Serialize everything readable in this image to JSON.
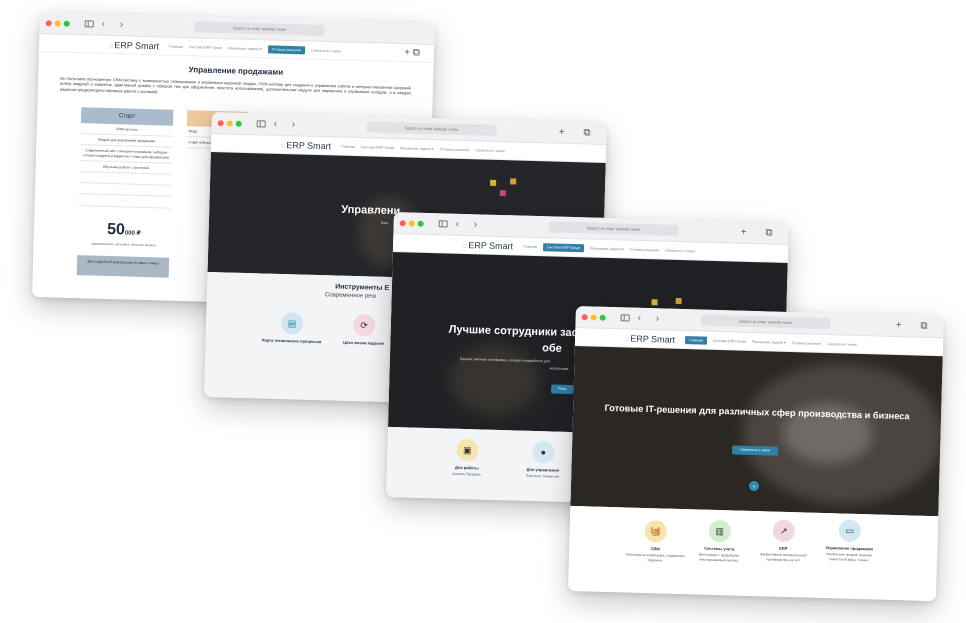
{
  "browser": {
    "address_placeholder": "Search or enter website name"
  },
  "site": {
    "logo": "ERP Smart",
    "nav": [
      "Главная",
      "Система ERP Smart",
      "Решаемые задачи ▾",
      "Готовые решения",
      "Связаться с нами"
    ]
  },
  "window1": {
    "title": "Управление продажами",
    "text": "Вы получаете полноценную CRM-систему с возможностью планирования и управления воронкой продаж, CRM-систему для создания и управления сайтом и интернет-магазином (широкий выбор модулей и виджетов, адаптивный дизайн с набором тем для оформления, простота использования), дополнительные модули для маркетинга и управления складом, а в каждом решении предусмотрено обучение работе с системой.",
    "plan": {
      "name": "Старт",
      "rows": [
        "CRM система",
        "Модуль для управления продажами",
        "Современный сайт с интернет-магазином, набором готовых модулей и виджетов + темы для оформления",
        "Обучение работе с системой",
        "-",
        "-",
        "-"
      ],
      "price": "50",
      "price_suffix": "000 ₽",
      "note": "единовременно, настройка, обучение проекта",
      "button": "Для подробной информации оставьте заявку"
    },
    "plan2": {
      "row": "Моду",
      "row2": "Совре набора",
      "button": "Для п"
    }
  },
  "window2": {
    "hero_title": "Управлени",
    "hero_sub": "Ваш",
    "section_title": "Инструменты Е",
    "section_sub": "Современное реш",
    "features": [
      {
        "title": "Карта технических процессов",
        "icon": "▤"
      },
      {
        "title": "Цикл жизни изделия",
        "icon": "⟳"
      }
    ]
  },
  "window3": {
    "hero_title_1": "Лучшие сотрудники засл",
    "hero_title_2": "обе",
    "hero_sub": "Единая сменная платформа, которая понадобится для",
    "hero_sub2": "использова",
    "cta": "Попр",
    "features": [
      {
        "title": "Для работы",
        "desc": "Закупки, Продажи,",
        "icon": "▣"
      },
      {
        "title": "Для управления",
        "desc": "Персонал, Маркетинг",
        "icon": "●"
      }
    ]
  },
  "window4": {
    "hero_title": "Готовые IT-решения для различных сфер производства и бизнеса",
    "cta": "Связаться с нами",
    "features": [
      {
        "title": "CRM",
        "desc": "Электронная коммерция, управление лидами и",
        "icon": "🧺"
      },
      {
        "title": "Системы учета",
        "desc": "Интеграция с продажами, многоуровневый анализ,",
        "icon": "▥"
      },
      {
        "title": "ERP",
        "desc": "Эффективная автоматизация производства, расчет",
        "icon": "↗"
      },
      {
        "title": "Управление продажами",
        "desc": "Увеличение продаж, ведение клиентской базы, точные",
        "icon": "▭"
      }
    ]
  },
  "colors": {
    "accent": "#2f7fa6",
    "plan_start": "#aabccc",
    "plan_mid": "#f0c9a0",
    "icon_yellow": "#f5e6b0",
    "icon_green": "#d6ecd2",
    "icon_pink": "#f3d9df",
    "icon_blue": "#d4e8f3"
  }
}
